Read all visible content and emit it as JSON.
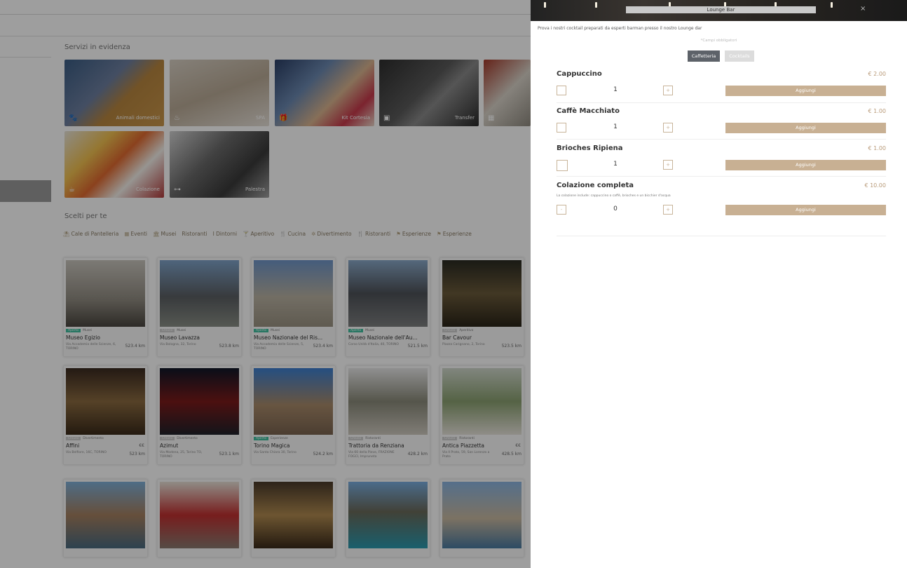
{
  "background": {
    "section_featured_title": "Servizi in evidenza",
    "section_chosen_title": "Scelti per te",
    "tiles": [
      {
        "label": "Animali domestici",
        "icon": "paw-icon",
        "glyph": "🐾"
      },
      {
        "label": "SPA",
        "icon": "spa-icon",
        "glyph": "♨"
      },
      {
        "label": "Kit Cortesia",
        "icon": "gift-icon",
        "glyph": "🎁"
      },
      {
        "label": "Transfer",
        "icon": "car-icon",
        "glyph": "▣"
      },
      {
        "label": "",
        "icon": "restaurant-icon",
        "glyph": "▦"
      },
      {
        "label": "Colazione",
        "icon": "breakfast-icon",
        "glyph": "☕"
      },
      {
        "label": "Palestra",
        "icon": "dumbbell-icon",
        "glyph": "⊶"
      }
    ],
    "categories": [
      {
        "label": "Cale di Pantelleria",
        "icon": "umbrella-icon",
        "glyph": "⛱"
      },
      {
        "label": "Eventi",
        "icon": "calendar-icon",
        "glyph": "▦"
      },
      {
        "label": "Musei",
        "icon": "museum-icon",
        "glyph": "🏛"
      },
      {
        "label": "Ristoranti",
        "icon": "",
        "glyph": ""
      },
      {
        "label": "I Dintorni",
        "icon": "",
        "glyph": ""
      },
      {
        "label": "Aperitivo",
        "icon": "cocktail-icon",
        "glyph": "🍸"
      },
      {
        "label": "Cucina",
        "icon": "cutlery-icon",
        "glyph": "🍴"
      },
      {
        "label": "Divertimento",
        "icon": "fun-icon",
        "glyph": "✲"
      },
      {
        "label": "Ristoranti",
        "icon": "cutlery-icon",
        "glyph": "🍴"
      },
      {
        "label": "Esperienze",
        "icon": "flag-icon",
        "glyph": "⚑"
      },
      {
        "label": "Esperienze",
        "icon": "flag-icon",
        "glyph": "⚑"
      }
    ],
    "cards": [
      {
        "status": "Aperto",
        "open": true,
        "category": "Musei",
        "title": "Museo Egizio",
        "address": "Via Accademia delle Scienze, 6, TORINO",
        "distance": "523.4 km",
        "price": ""
      },
      {
        "status": "Chiuso",
        "open": false,
        "category": "Musei",
        "title": "Museo Lavazza",
        "address": "Via Bologna, 32, Torino",
        "distance": "523.8 km",
        "price": ""
      },
      {
        "status": "Aperto",
        "open": true,
        "category": "Musei",
        "title": "Museo Nazionale del Ris...",
        "address": "Via Accademia delle Scienze, 5, TORINO",
        "distance": "523.4 km",
        "price": ""
      },
      {
        "status": "Aperto",
        "open": true,
        "category": "Musei",
        "title": "Museo Nazionale dell'Au...",
        "address": "Corso Unità d'Italia, 40, TORINO",
        "distance": "521.5 km",
        "price": ""
      },
      {
        "status": "Chiuso",
        "open": false,
        "category": "Aperitivo",
        "title": "Bar Cavour",
        "address": "Piazza Carignano, 2, Torino",
        "distance": "523.5 km",
        "price": ""
      },
      {
        "status": "Chiuso",
        "open": false,
        "category": "Divertimento",
        "title": "Affini",
        "address": "Via Belfiore, 16C, TORINO",
        "distance": "523 km",
        "price": "€€"
      },
      {
        "status": "Chiuso",
        "open": false,
        "category": "Divertimento",
        "title": "Azimut",
        "address": "Via Modena, 25, Torino TO, TORINO",
        "distance": "523.1 km",
        "price": ""
      },
      {
        "status": "Aperto",
        "open": true,
        "category": "Esperienze",
        "title": "Torino Magica",
        "address": "Via Santa Chiara 30, Torino",
        "distance": "524.2 km",
        "price": ""
      },
      {
        "status": "Chiuso",
        "open": false,
        "category": "Ristoranti",
        "title": "Trattoria da Renziana",
        "address": "Via 60 della Pieve, FRAZIONE FOGCI, Impruneta",
        "distance": "428.2 km",
        "price": ""
      },
      {
        "status": "Chiuso",
        "open": false,
        "category": "Ristoranti",
        "title": "Antica Piazzetta",
        "address": "Via Il Prato, 59, San Lorenzo a Prato",
        "distance": "428.5 km",
        "price": "€€"
      },
      {
        "status": "",
        "open": false,
        "category": "",
        "title": "",
        "address": "",
        "distance": "",
        "price": ""
      },
      {
        "status": "",
        "open": false,
        "category": "",
        "title": "",
        "address": "",
        "distance": "",
        "price": ""
      },
      {
        "status": "",
        "open": false,
        "category": "",
        "title": "",
        "address": "",
        "distance": "",
        "price": ""
      },
      {
        "status": "",
        "open": false,
        "category": "",
        "title": "",
        "address": "",
        "distance": "",
        "price": ""
      },
      {
        "status": "",
        "open": false,
        "category": "",
        "title": "",
        "address": "",
        "distance": "",
        "price": ""
      }
    ]
  },
  "panel": {
    "title": "Lounge Bar",
    "close_glyph": "×",
    "description": "Prova i nostri cocktail preparati da esperti barman presso il nostro Lounge dar",
    "required_note": "*Campi obbligatori",
    "tabs": [
      {
        "label": "Caffetteria",
        "active": true
      },
      {
        "label": "Cocktails",
        "active": false
      }
    ],
    "items": [
      {
        "name": "Cappuccino",
        "price": "€ 2.00",
        "note": "",
        "qty": "1",
        "minus": "",
        "plus": "+",
        "add": "Aggiungi"
      },
      {
        "name": "Caffè Macchiato",
        "price": "€ 1.00",
        "note": "",
        "qty": "1",
        "minus": "",
        "plus": "+",
        "add": "Aggiungi"
      },
      {
        "name": "Brioches Ripiena",
        "price": "€ 1.00",
        "note": "",
        "qty": "1",
        "minus": "",
        "plus": "+",
        "add": "Aggiungi"
      },
      {
        "name": "Colazione completa",
        "price": "€ 10.00",
        "note": "La colazione include: cappuccino o caffè, brioches e un bicchier d'acqua",
        "qty": "0",
        "minus": "-",
        "plus": "+",
        "add": "Aggiungi"
      }
    ]
  }
}
